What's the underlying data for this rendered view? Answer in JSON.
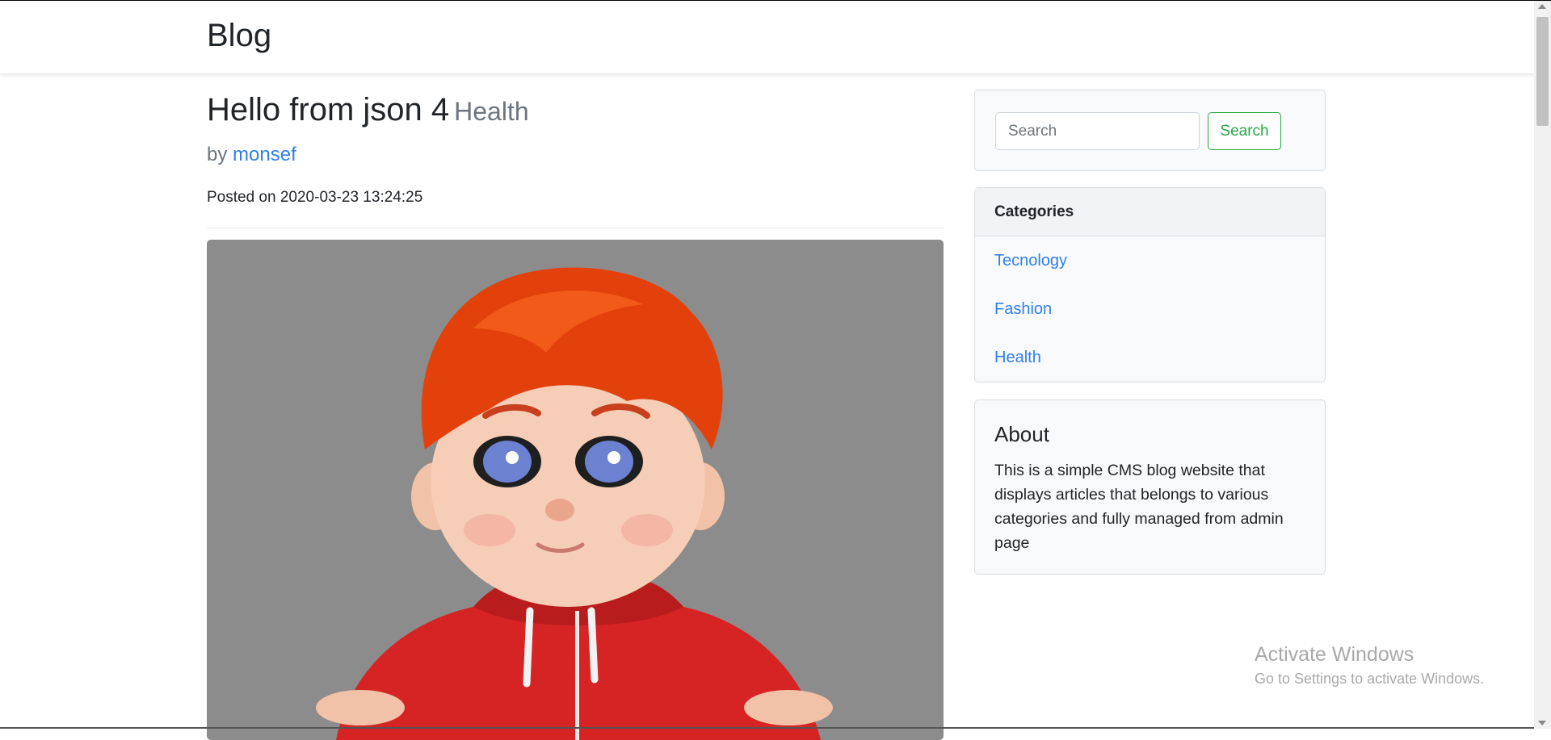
{
  "navbar": {
    "brand": "Blog"
  },
  "post": {
    "title": "Hello from json 4",
    "category": "Health",
    "by_prefix": "by",
    "author": "monsef",
    "posted": "Posted on 2020-03-23 13:24:25",
    "image_alt": "cartoon boy with red hair in red hoodie"
  },
  "sidebar": {
    "search": {
      "placeholder": "Search",
      "button_label": "Search"
    },
    "categories": {
      "title": "Categories",
      "items": [
        "Tecnology",
        "Fashion",
        "Health"
      ]
    },
    "about": {
      "title": "About",
      "text": "This is a simple CMS blog website that displays articles that belongs to various categories and fully managed from admin page"
    }
  },
  "watermark": {
    "title": "Activate Windows",
    "subtitle": "Go to Settings to activate Windows."
  },
  "colors": {
    "link": "#2f80ed",
    "success": "#28a745",
    "muted": "#6c757d",
    "card_bg": "#f8f9fa",
    "image_bg": "#8c8c8c"
  }
}
